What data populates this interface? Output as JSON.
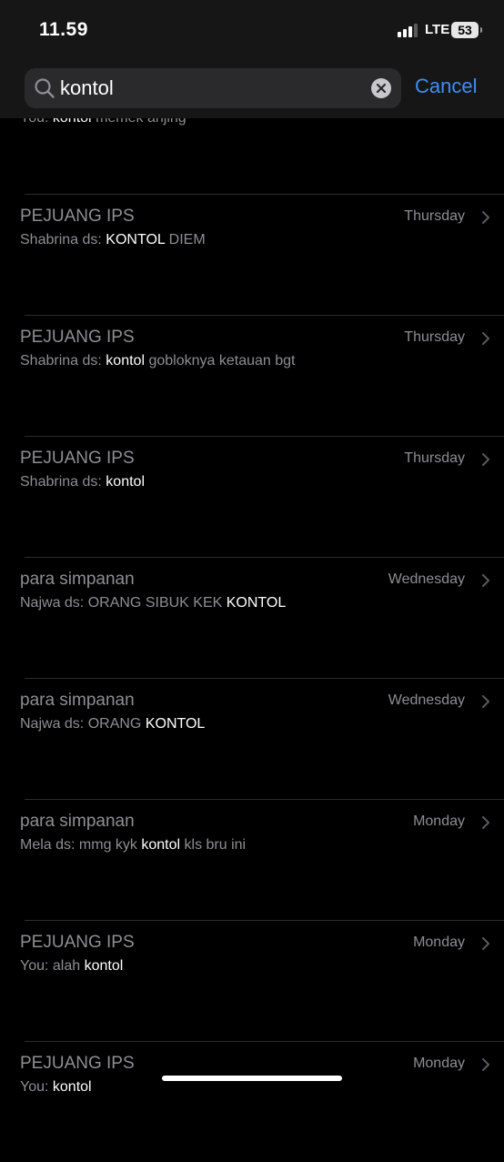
{
  "status_bar": {
    "time": "11.59",
    "network": "LTE",
    "battery": "53"
  },
  "search": {
    "value": "kontol",
    "cancel_label": "Cancel"
  },
  "partial_row": {
    "sender": "You:",
    "match": "kontol",
    "after": "memek anjing"
  },
  "results": [
    {
      "title": "PEJUANG IPS",
      "date": "Thursday",
      "sender": "Shabrina ds:",
      "before": "",
      "match": "KONTOL",
      "after": "DIEM"
    },
    {
      "title": "PEJUANG IPS",
      "date": "Thursday",
      "sender": "Shabrina ds:",
      "before": "",
      "match": "kontol",
      "after": "gobloknya ketauan bgt"
    },
    {
      "title": "PEJUANG IPS",
      "date": "Thursday",
      "sender": "Shabrina ds:",
      "before": "",
      "match": "kontol",
      "after": ""
    },
    {
      "title": "para simpanan",
      "date": "Wednesday",
      "sender": "Najwa ds:",
      "before": "ORANG SIBUK KEK",
      "match": "KONTOL",
      "after": ""
    },
    {
      "title": "para simpanan",
      "date": "Wednesday",
      "sender": "Najwa ds:",
      "before": "ORANG",
      "match": "KONTOL",
      "after": ""
    },
    {
      "title": "para simpanan",
      "date": "Monday",
      "sender": "Mela ds:",
      "before": "mmg kyk",
      "match": "kontol",
      "after": "kls bru ini"
    },
    {
      "title": "PEJUANG IPS",
      "date": "Monday",
      "sender": "You:",
      "before": "alah",
      "match": "kontol",
      "after": ""
    },
    {
      "title": "PEJUANG IPS",
      "date": "Monday",
      "sender": "You:",
      "before": "",
      "match": "kontol",
      "after": ""
    }
  ]
}
